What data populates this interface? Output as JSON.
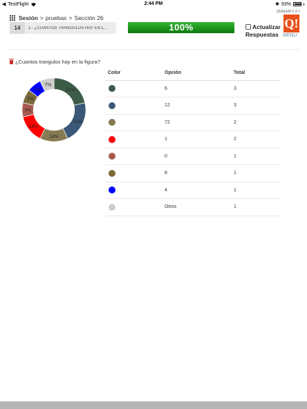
{
  "status_bar": {
    "app_back": "TestFlight",
    "time": "2:44 PM",
    "battery_text": "93%",
    "battery_level": 0.93
  },
  "header": {
    "breadcrumb": {
      "session_label": "Sesión",
      "sep1": ">",
      "session_name": "pruebax",
      "sep2": ">",
      "section": "Sección 26"
    },
    "question_number": "14",
    "question_option": "1.- ¿CUANTOS TRANGULOS HAY EN L...",
    "progress": {
      "label": "100%",
      "value": 1.0
    },
    "refresh": {
      "line1": "Actualizar",
      "line2": "Respuestas"
    },
    "version": "QUALEM V 2.7",
    "logo_text": "Q!",
    "menu_label": "MENÚ"
  },
  "question_title": "¿Cuantos trangulos hay en la figura?",
  "table": {
    "headers": {
      "color": "Color",
      "option": "Opción",
      "total": "Total"
    },
    "rows": [
      {
        "color": "#3d5c47",
        "option": "6",
        "total": "3"
      },
      {
        "color": "#3c5878",
        "option": "12",
        "total": "3"
      },
      {
        "color": "#857a52",
        "option": "72",
        "total": "2"
      },
      {
        "color": "#ff0000",
        "option": "1",
        "total": "2"
      },
      {
        "color": "#a55a50",
        "option": "0",
        "total": "1"
      },
      {
        "color": "#7a6a3a",
        "option": "8",
        "total": "1"
      },
      {
        "color": "#0000ff",
        "option": "4",
        "total": "1"
      },
      {
        "color": "#cccccc",
        "option": "Otros",
        "total": "1"
      }
    ]
  },
  "chart_data": {
    "type": "pie",
    "variant": "donut",
    "categories": [
      "6",
      "12",
      "72",
      "1",
      "0",
      "8",
      "4",
      "Otros"
    ],
    "values": [
      3,
      3,
      2,
      2,
      1,
      1,
      1,
      1
    ],
    "colors": [
      "#3d5c47",
      "#3c5878",
      "#857a52",
      "#ff0000",
      "#a55a50",
      "#7a6a3a",
      "#0000ff",
      "#cccccc"
    ],
    "slice_labels": [
      "21%",
      "21%",
      "14%",
      "14%",
      "7%",
      "7%",
      "7%",
      "7%"
    ]
  }
}
